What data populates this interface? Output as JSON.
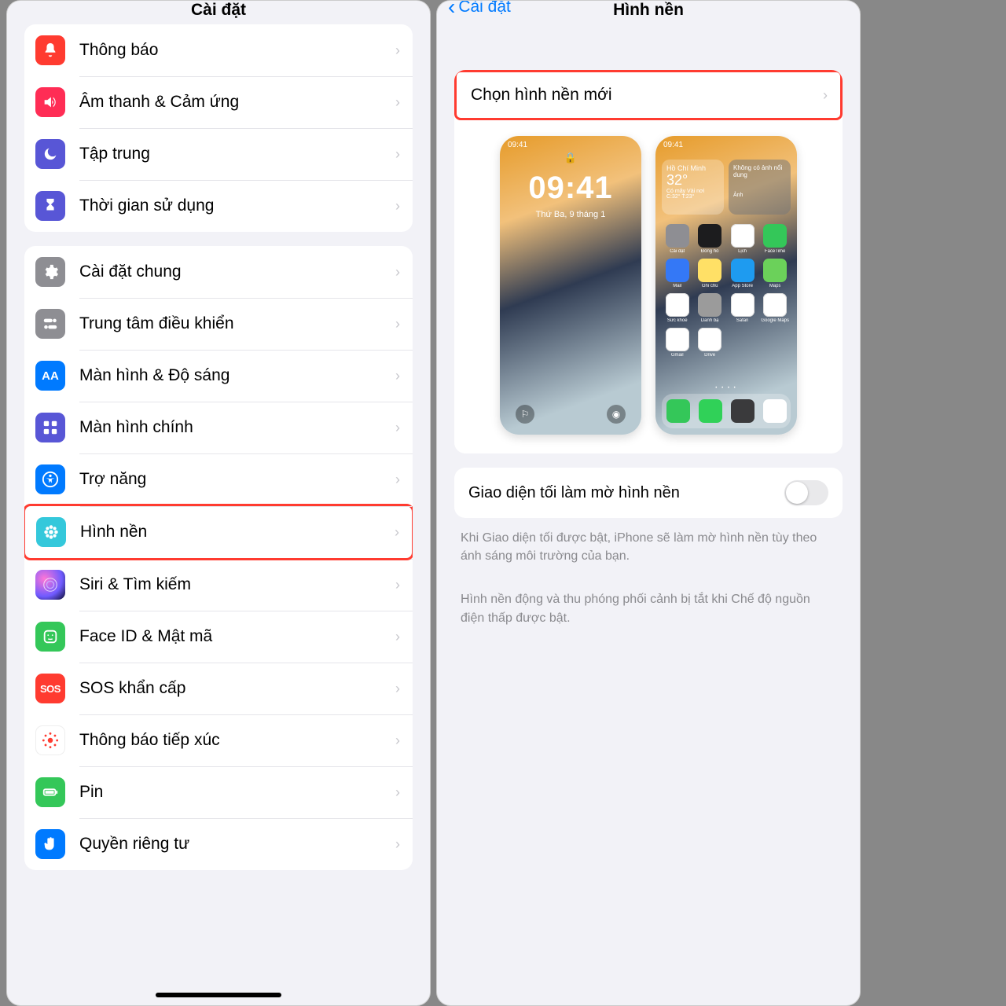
{
  "left": {
    "title": "Cài đặt",
    "groups": [
      {
        "rows": [
          {
            "id": "notifications",
            "label": "Thông báo",
            "icon": "bell",
            "bg": "bg-red"
          },
          {
            "id": "sounds",
            "label": "Âm thanh & Cảm ứng",
            "icon": "speaker",
            "bg": "bg-pink"
          },
          {
            "id": "focus",
            "label": "Tập trung",
            "icon": "moon",
            "bg": "bg-indigo"
          },
          {
            "id": "screentime",
            "label": "Thời gian sử dụng",
            "icon": "hourglass",
            "bg": "bg-indigo"
          }
        ]
      },
      {
        "rows": [
          {
            "id": "general",
            "label": "Cài đặt chung",
            "icon": "gear",
            "bg": "bg-gray"
          },
          {
            "id": "control-center",
            "label": "Trung tâm điều khiển",
            "icon": "switches",
            "bg": "bg-gray"
          },
          {
            "id": "display",
            "label": "Màn hình & Độ sáng",
            "icon": "AA",
            "bg": "bg-blue"
          },
          {
            "id": "home-screen",
            "label": "Màn hình chính",
            "icon": "grid",
            "bg": "bg-indigo"
          },
          {
            "id": "accessibility",
            "label": "Trợ năng",
            "icon": "access",
            "bg": "bg-blue"
          },
          {
            "id": "wallpaper",
            "label": "Hình nền",
            "icon": "flower",
            "bg": "bg-cyan",
            "highlight": true
          },
          {
            "id": "siri",
            "label": "Siri & Tìm kiếm",
            "icon": "siri",
            "bg": "siri-icon"
          },
          {
            "id": "faceid",
            "label": "Face ID & Mật mã",
            "icon": "face",
            "bg": "bg-green"
          },
          {
            "id": "sos",
            "label": "SOS khẩn cấp",
            "icon": "SOS",
            "bg": "bg-sos"
          },
          {
            "id": "exposure",
            "label": "Thông báo tiếp xúc",
            "icon": "exposure",
            "bg": "bg-exposure"
          },
          {
            "id": "battery",
            "label": "Pin",
            "icon": "battery",
            "bg": "bg-green"
          },
          {
            "id": "privacy",
            "label": "Quyền riêng tư",
            "icon": "hand",
            "bg": "bg-blue"
          }
        ]
      }
    ]
  },
  "right": {
    "back": "Cài đặt",
    "title": "Hình nền",
    "choose_label": "Chọn hình nền mới",
    "lock": {
      "time": "09:41",
      "date": "Thứ Ba, 9 tháng 1",
      "status": "09:41"
    },
    "home": {
      "status": "09:41",
      "weather": {
        "city": "Hồ Chí Minh",
        "temp": "32°",
        "desc": "Có mây Vài nơi\nC:32° T:23°"
      },
      "widget2": "Không có ảnh nổi dung",
      "widget2_sub": "Ảnh",
      "apps": [
        {
          "n": "Cài đặt",
          "c": "#8e8e93"
        },
        {
          "n": "Đồng hồ",
          "c": "#1c1c1e"
        },
        {
          "n": "Lịch",
          "c": "#ffffff"
        },
        {
          "n": "FaceTime",
          "c": "#34c759"
        },
        {
          "n": "Mail",
          "c": "#3478f6"
        },
        {
          "n": "Ghi chú",
          "c": "#ffe066"
        },
        {
          "n": "App Store",
          "c": "#1e9bf0"
        },
        {
          "n": "Maps",
          "c": "#6bd15a"
        },
        {
          "n": "Sức khỏe",
          "c": "#ffffff"
        },
        {
          "n": "Danh bạ",
          "c": "#9b9b9b"
        },
        {
          "n": "Safari",
          "c": "#ffffff"
        },
        {
          "n": "Google Maps",
          "c": "#ffffff"
        },
        {
          "n": "Gmail",
          "c": "#ffffff"
        },
        {
          "n": "Drive",
          "c": "#ffffff"
        },
        {
          "n": "",
          "c": ""
        },
        {
          "n": "",
          "c": ""
        }
      ],
      "dock": [
        {
          "c": "#34c759"
        },
        {
          "c": "#30d158"
        },
        {
          "c": "#3a3a3c"
        },
        {
          "c": "#ffffff"
        }
      ]
    },
    "toggle_label": "Giao diện tối làm mờ hình nền",
    "toggle_on": false,
    "footnote1": "Khi Giao diện tối được bật, iPhone sẽ làm mờ hình nền tùy theo ánh sáng môi trường của bạn.",
    "footnote2": "Hình nền động và thu phóng phối cảnh bị tắt khi Chế độ nguồn điện thấp được bật."
  }
}
